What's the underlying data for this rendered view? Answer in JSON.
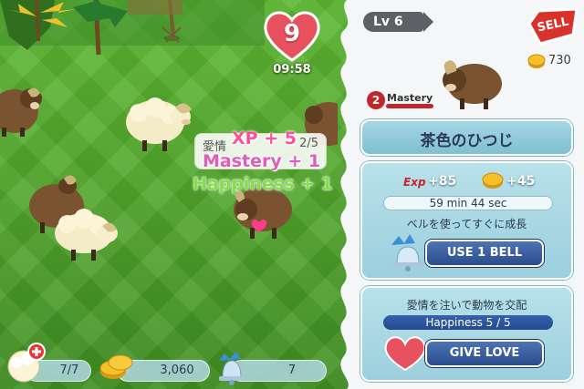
{
  "game": {
    "heart_count": "9",
    "heart_timer": "09:58"
  },
  "tooltip": {
    "label": "愛情",
    "value": "2/5"
  },
  "floating_text": {
    "xp": "XP + 5",
    "mastery": "Mastery + 1",
    "happiness": "Happiness + 1"
  },
  "hud": {
    "animals": "7/7",
    "coins": "3,060",
    "bells": "7"
  },
  "panel": {
    "level": "Lv 6",
    "sell_label": "SELL",
    "coin_value": "730",
    "mastery_level": "2",
    "mastery_label": "Mastery",
    "animal_name": "茶色のひつじ",
    "exp_tag": "Exp",
    "exp_reward": "+85",
    "coin_reward": "+45",
    "time_remaining": "59 min 44 sec",
    "bell_message": "ベルを使ってすぐに成長",
    "use_bell_label": "USE 1 BELL",
    "love_message": "愛情を注いで動物を交配",
    "happiness": "Happiness 5 / 5",
    "give_love_label": "GIVE LOVE"
  },
  "colors": {
    "grass": "#4fa52c",
    "heart": "#e8525e",
    "panel_blue": "#9ccfdd",
    "button_blue": "#2a4c8c",
    "sell_red": "#d9322d"
  }
}
